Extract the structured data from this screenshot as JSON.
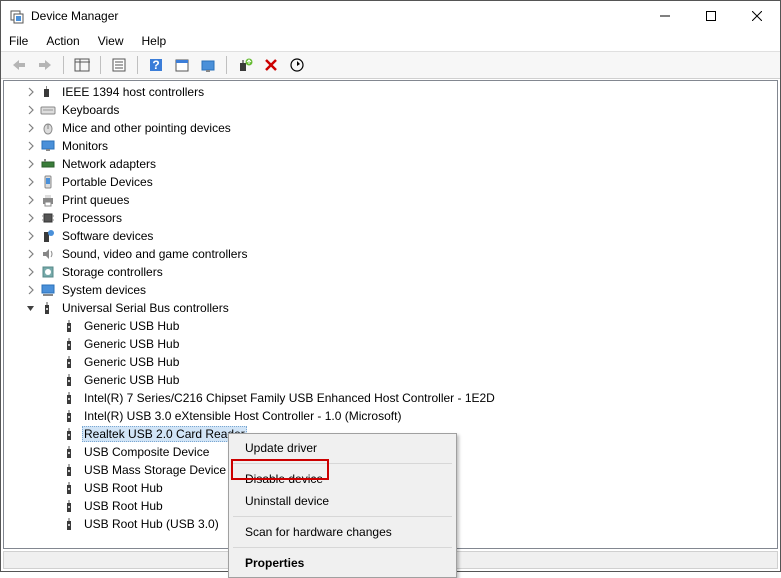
{
  "window": {
    "title": "Device Manager",
    "menus": {
      "file": "File",
      "action": "Action",
      "view": "View",
      "help": "Help"
    },
    "buttons": {
      "min": "—",
      "max": "☐",
      "close": "✕"
    }
  },
  "toolbar_icons": {
    "back": "back-arrow-icon",
    "fwd": "forward-arrow-icon",
    "props_panel": "properties-pane-icon",
    "list": "list-icon",
    "help": "help-icon",
    "calendar": "calendar-icon",
    "monitor": "monitor-icon",
    "update": "update-driver-icon",
    "disable": "disable-icon",
    "uninstall": "uninstall-icon"
  },
  "tree": {
    "categories": [
      {
        "label": "IEEE 1394 host controllers",
        "icon": "ieee1394-icon"
      },
      {
        "label": "Keyboards",
        "icon": "keyboard-icon"
      },
      {
        "label": "Mice and other pointing devices",
        "icon": "mouse-icon"
      },
      {
        "label": "Monitors",
        "icon": "monitor-icon"
      },
      {
        "label": "Network adapters",
        "icon": "network-icon"
      },
      {
        "label": "Portable Devices",
        "icon": "portable-icon"
      },
      {
        "label": "Print queues",
        "icon": "printer-icon"
      },
      {
        "label": "Processors",
        "icon": "processor-icon"
      },
      {
        "label": "Software devices",
        "icon": "software-icon"
      },
      {
        "label": "Sound, video and game controllers",
        "icon": "sound-icon"
      },
      {
        "label": "Storage controllers",
        "icon": "storage-icon"
      },
      {
        "label": "System devices",
        "icon": "system-icon"
      }
    ],
    "usb_category": {
      "label": "Universal Serial Bus controllers",
      "icon": "usb-controller-icon"
    },
    "usb_devices": [
      {
        "label": "Generic USB Hub"
      },
      {
        "label": "Generic USB Hub"
      },
      {
        "label": "Generic USB Hub"
      },
      {
        "label": "Generic USB Hub"
      },
      {
        "label": "Intel(R) 7 Series/C216 Chipset Family USB Enhanced Host Controller - 1E2D"
      },
      {
        "label": "Intel(R) USB 3.0 eXtensible Host Controller - 1.0 (Microsoft)"
      },
      {
        "label": "Realtek USB 2.0 Card Reader",
        "selected": true
      },
      {
        "label": "USB Composite Device"
      },
      {
        "label": "USB Mass Storage Device"
      },
      {
        "label": "USB Root Hub"
      },
      {
        "label": "USB Root Hub"
      },
      {
        "label": "USB Root Hub (USB 3.0)"
      }
    ]
  },
  "context_menu": {
    "update": "Update driver",
    "disable": "Disable device",
    "uninstall": "Uninstall device",
    "scan": "Scan for hardware changes",
    "properties": "Properties"
  }
}
